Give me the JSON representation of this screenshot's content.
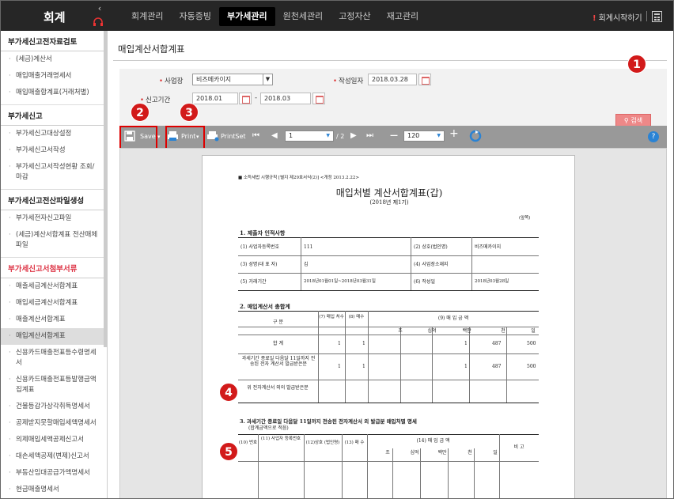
{
  "app": {
    "logo": "회계",
    "collapse": "‹"
  },
  "nav": [
    {
      "label": "회계관리"
    },
    {
      "label": "자동증빙"
    },
    {
      "label": "부가세관리",
      "active": true
    },
    {
      "label": "원천세관리"
    },
    {
      "label": "고정자산"
    },
    {
      "label": "재고관리"
    }
  ],
  "header": {
    "start_icon": "!",
    "start_label": "회계시작하기"
  },
  "sidebar": {
    "groups": [
      {
        "title": "부가세신고전자료검토",
        "items": [
          "(세금)계산서",
          "매입매출거래명세서",
          "매입매출합계표(거래처별)"
        ]
      },
      {
        "title": "부가세신고",
        "items": [
          "부가세신고대상설정",
          "부가세신고서작성",
          "부가세신고서작성현황 조회/마감"
        ]
      },
      {
        "title": "부가세신고전산파일생성",
        "items": [
          "부가세전자신고파일",
          "(세금)계산서합계표 전산매체파일"
        ]
      },
      {
        "title": "부가세신고서첨부서류",
        "items": [
          "매출세금계산서합계표",
          "매입세금계산서합계표",
          "매출계산서합계표",
          "매입계산서합계표",
          "신용카드매출전표등수령명세서",
          "신용카드매출전표등발행금액집계표",
          "건물등감가상각취득명세서",
          "공제받지못할매입세액명세서",
          "의제매입세액공제신고서",
          "대손세액공제(변제)신고서",
          "부동산임대공급가액명세서",
          "현금매출명세서"
        ]
      }
    ]
  },
  "page": {
    "title": "매입계산서합계표"
  },
  "form": {
    "biz_label": "사업장",
    "biz_value": "비즈메카이지",
    "date_label": "작성일자",
    "date_value": "2018.03.28",
    "period_label": "신고기간",
    "period_from": "2018.01",
    "period_sep": "-",
    "period_to": "2018.03",
    "search_label": "검색"
  },
  "toolbar": {
    "save": "Save",
    "print": "Print",
    "printset": "PrintSet",
    "page": "1",
    "total": "/ 2",
    "zoom": "120",
    "help": "?"
  },
  "badges": [
    "1",
    "2",
    "3",
    "4",
    "5"
  ],
  "report": {
    "note": "■ 소득세법 시행규칙 [별지 제29호서식(2)] <개정 2013.2.22>",
    "title": "매입처별 계산서합계표(갑)",
    "year": "(2018년 제1기)",
    "unit": "(앞쪽)",
    "s1": "1. 제출자 인적사항",
    "r1": {
      "l1": "(1) 사업자등록번호",
      "v1": "111",
      "l2": "(2) 상호(법인명)",
      "v2": "비즈메카이지"
    },
    "r2": {
      "l1": "(3) 성명(대 표 자)",
      "v1": "김",
      "l2": "(4) 사업장소재지",
      "v2": ""
    },
    "r3": {
      "l1": "(5) 거래기간",
      "v1": "2018년01월01일~2018년03월31일",
      "l2": "(6) 작성일",
      "v2": "2018년03월28일"
    },
    "s2": "2. 매입계산서 총합계",
    "h2": {
      "c1": "구 분",
      "c2": "(7) 매입 처수",
      "c3": "(8) 매수",
      "c4": "(9) 매 입 금 액",
      "u": [
        "조",
        "십억",
        "백만",
        "천",
        "일"
      ]
    },
    "rows2": [
      {
        "label": "합 계",
        "a": "1",
        "b": "1",
        "m": "1",
        "t": "487",
        "o": "500"
      },
      {
        "label": "과세기간 종료일 다음달 11일까지 전송된 전자 계산서 발급받은분",
        "a": "1",
        "b": "1",
        "m": "1",
        "t": "487",
        "o": "500"
      },
      {
        "label": "위 전자계산서 외의 발급받은분",
        "a": "",
        "b": "",
        "m": "",
        "t": "",
        "o": ""
      }
    ],
    "s3": "3. 과세기간 종료일 다음달 11일까지 전송된 전자계산서 외 발급분 매입처별 명세",
    "s3b": "(합계금액으로 적음)",
    "h3": {
      "c1": "(10) 번호",
      "c2": "(11) 사업자 등록번호",
      "c3": "(12)상호 (법인명)",
      "c4": "(13) 매 수",
      "c5": "(14) 매 입 금 액",
      "c6": "비 고",
      "u": [
        "조",
        "십억",
        "백만",
        "천",
        "일"
      ]
    }
  },
  "colors": {
    "accent": "#d21a1a",
    "topbar": "#262626",
    "toolbar": "#999999",
    "help": "#2a83d4"
  }
}
